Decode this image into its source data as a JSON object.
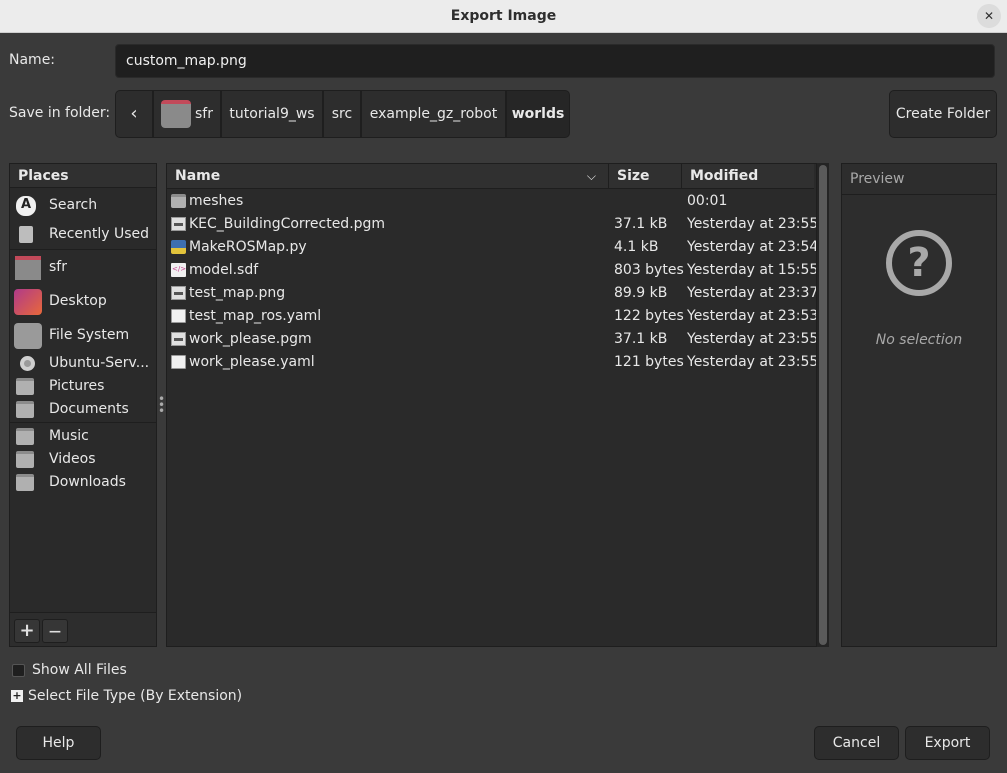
{
  "window": {
    "title": "Export Image",
    "close_icon": "close-icon"
  },
  "name_row": {
    "label": "Name:",
    "value": "custom_map.png"
  },
  "folder_row": {
    "label": "Save in folder:",
    "back_glyph": "‹",
    "crumbs": [
      "sfr",
      "tutorial9_ws",
      "src",
      "example_gz_robot",
      "worlds"
    ],
    "active_crumb": "worlds",
    "create_folder": "Create Folder"
  },
  "places": {
    "header": "Places",
    "items": [
      {
        "label": "Search",
        "icon": "search-icon"
      },
      {
        "label": "Recently Used",
        "icon": "recent-icon"
      },
      {
        "label": "sfr",
        "icon": "home-folder-icon"
      },
      {
        "label": "Desktop",
        "icon": "desktop-icon"
      },
      {
        "label": "File System",
        "icon": "drive-icon"
      },
      {
        "label": "Ubuntu-Serv...",
        "icon": "disc-icon"
      },
      {
        "label": "Pictures",
        "icon": "folder-icon"
      },
      {
        "label": "Documents",
        "icon": "folder-icon"
      },
      {
        "label": "Music",
        "icon": "folder-icon"
      },
      {
        "label": "Videos",
        "icon": "folder-icon"
      },
      {
        "label": "Downloads",
        "icon": "folder-icon"
      }
    ],
    "add_label": "+",
    "remove_label": "—"
  },
  "files": {
    "columns": {
      "name": "Name",
      "size": "Size",
      "modified": "Modified"
    },
    "rows": [
      {
        "name": "meshes",
        "size": "",
        "modified": "00:01",
        "icon": "folder-icon"
      },
      {
        "name": "KEC_BuildingCorrected.pgm",
        "size": "37.1 kB",
        "modified": "Yesterday at 23:55",
        "icon": "image-file-icon"
      },
      {
        "name": "MakeROSMap.py",
        "size": "4.1 kB",
        "modified": "Yesterday at 23:54",
        "icon": "python-file-icon"
      },
      {
        "name": "model.sdf",
        "size": "803 bytes",
        "modified": "Yesterday at 15:55",
        "icon": "xml-file-icon"
      },
      {
        "name": "test_map.png",
        "size": "89.9 kB",
        "modified": "Yesterday at 23:37",
        "icon": "image-file-icon"
      },
      {
        "name": "test_map_ros.yaml",
        "size": "122 bytes",
        "modified": "Yesterday at 23:53",
        "icon": "text-file-icon"
      },
      {
        "name": "work_please.pgm",
        "size": "37.1 kB",
        "modified": "Yesterday at 23:55",
        "icon": "image-file-icon"
      },
      {
        "name": "work_please.yaml",
        "size": "121 bytes",
        "modified": "Yesterday at 23:55",
        "icon": "text-file-icon"
      }
    ]
  },
  "preview": {
    "title": "Preview",
    "empty_text": "No selection",
    "icon": "question-icon"
  },
  "options": {
    "show_all_files": "Show All Files",
    "show_all_checked": false,
    "file_type": "Select File Type (By Extension)"
  },
  "buttons": {
    "help": "Help",
    "cancel": "Cancel",
    "export": "Export"
  }
}
